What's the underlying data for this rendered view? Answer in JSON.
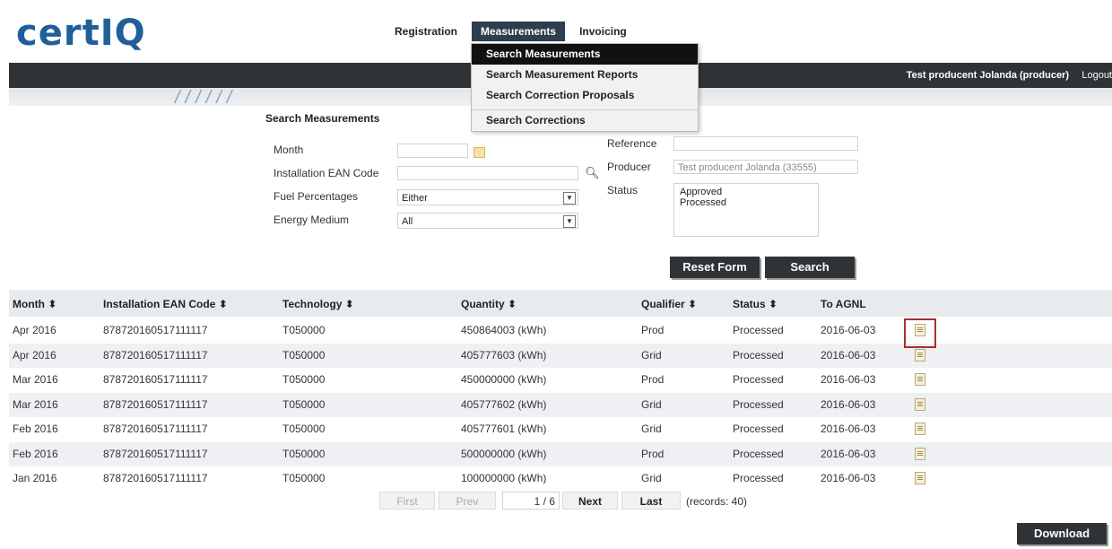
{
  "logo": {
    "text": "certIQ"
  },
  "nav": {
    "registration": "Registration",
    "measurements": "Measurements",
    "invoicing": "Invoicing"
  },
  "dropdown": {
    "items": [
      "Search Measurements",
      "Search Measurement Reports",
      "Search Correction Proposals",
      "Search Corrections"
    ]
  },
  "header": {
    "user": "Test producent Jolanda (producer)",
    "logout": "Logout"
  },
  "form": {
    "title": "Search Measurements",
    "month_label": "Month",
    "month_value": "",
    "ean_label": "Installation EAN Code",
    "ean_value": "",
    "fuel_label": "Fuel Percentages",
    "fuel_value": "Either",
    "energy_label": "Energy Medium",
    "energy_value": "All",
    "reference_label": "Reference",
    "reference_value": "",
    "producer_label": "Producer",
    "producer_value": "Test producent Jolanda (33555)",
    "status_label": "Status",
    "status_options": [
      "Approved",
      "Processed"
    ],
    "reset_label": "Reset Form",
    "search_label": "Search"
  },
  "table": {
    "headers": [
      "Month",
      "Installation EAN Code",
      "Technology",
      "Quantity",
      "Qualifier",
      "Status",
      "To AGNL"
    ],
    "sort_glyph": "⬍",
    "rows": [
      [
        "Apr 2016",
        "878720160517111117",
        "T050000",
        "450864003 (kWh)",
        "Prod",
        "Processed",
        "2016-06-03"
      ],
      [
        "Apr 2016",
        "878720160517111117",
        "T050000",
        "405777603 (kWh)",
        "Grid",
        "Processed",
        "2016-06-03"
      ],
      [
        "Mar 2016",
        "878720160517111117",
        "T050000",
        "450000000 (kWh)",
        "Prod",
        "Processed",
        "2016-06-03"
      ],
      [
        "Mar 2016",
        "878720160517111117",
        "T050000",
        "405777602 (kWh)",
        "Grid",
        "Processed",
        "2016-06-03"
      ],
      [
        "Feb 2016",
        "878720160517111117",
        "T050000",
        "405777601 (kWh)",
        "Grid",
        "Processed",
        "2016-06-03"
      ],
      [
        "Feb 2016",
        "878720160517111117",
        "T050000",
        "500000000 (kWh)",
        "Prod",
        "Processed",
        "2016-06-03"
      ],
      [
        "Jan 2016",
        "878720160517111117",
        "T050000",
        "100000000 (kWh)",
        "Grid",
        "Processed",
        "2016-06-03"
      ]
    ]
  },
  "pagination": {
    "first": "First",
    "prev": "Prev",
    "page": "1 / 6",
    "next": "Next",
    "last": "Last",
    "records": "(records: 40)"
  },
  "download": {
    "label": "Download"
  }
}
